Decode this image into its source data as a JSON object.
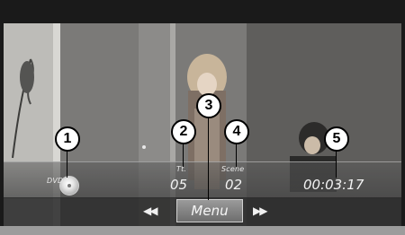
{
  "info_bar": {
    "disc_label": "DVD",
    "title_label": "Tt.",
    "title_value": "05",
    "scene_label": "Scene",
    "scene_value": "02",
    "time_value": "00:03:17"
  },
  "controls": {
    "menu_label": "Menu",
    "prev_icon": "skip-back-icon",
    "next_icon": "skip-forward-icon"
  },
  "callouts": [
    "1",
    "2",
    "3",
    "4",
    "5"
  ],
  "colors": {
    "frame": "#1a1a1a",
    "bar": "#5a5a5a",
    "callout_fill": "#ffffff",
    "callout_border": "#000000"
  }
}
